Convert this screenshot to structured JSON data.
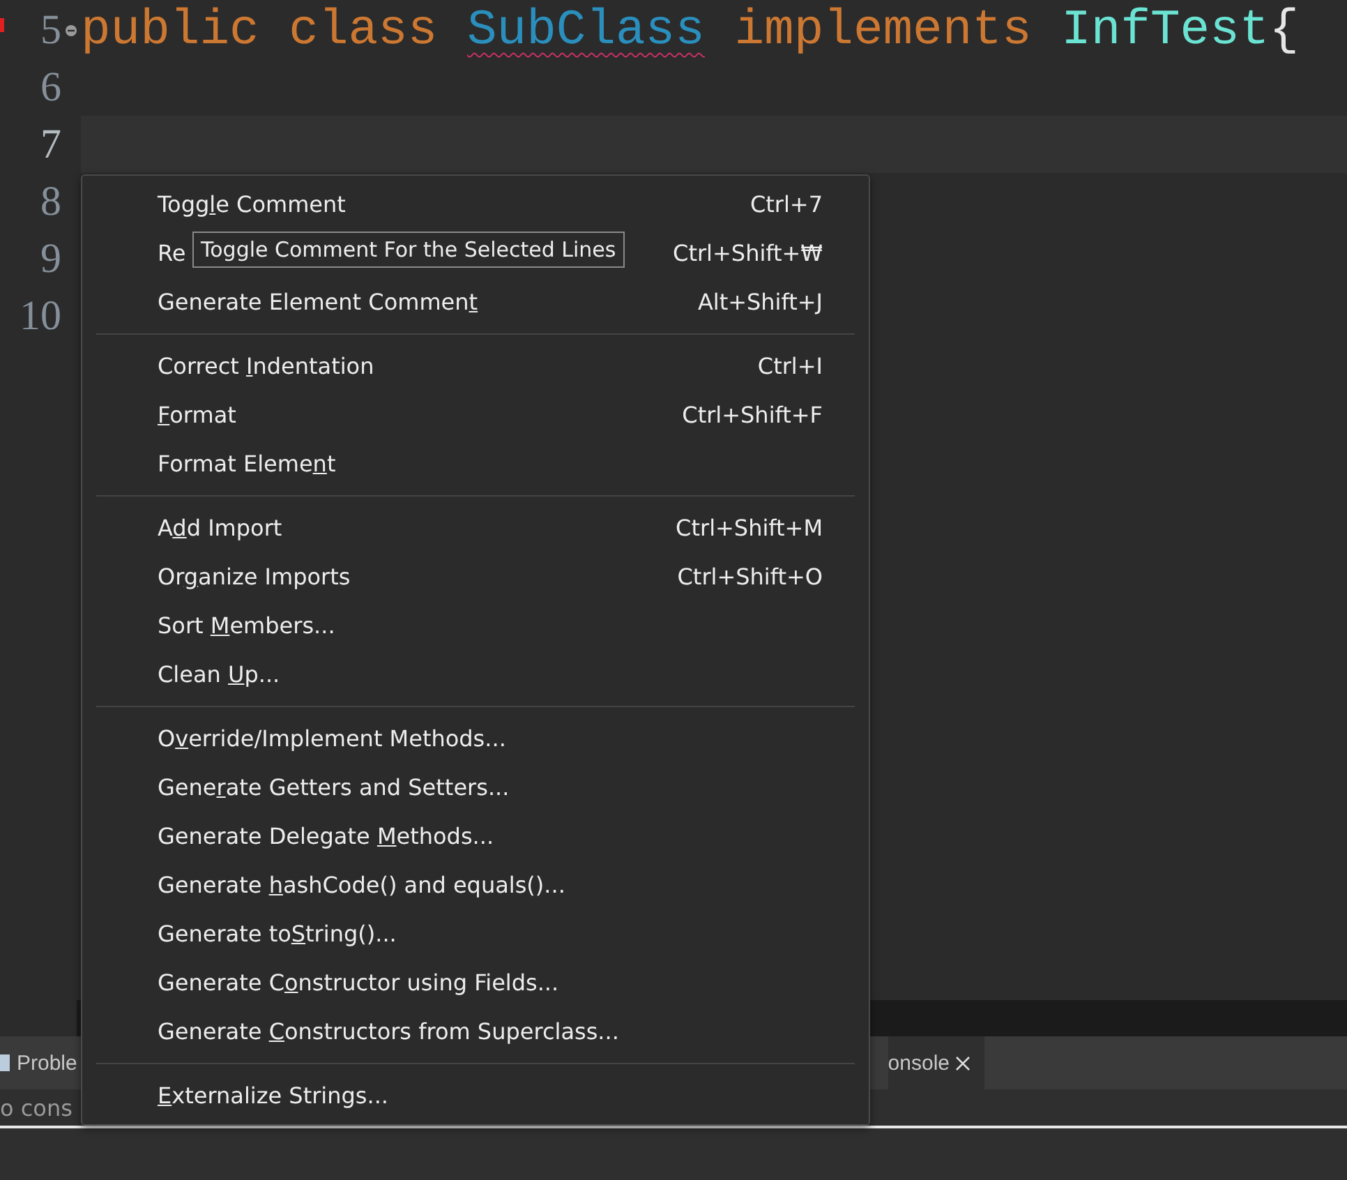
{
  "editor": {
    "lines": [
      {
        "number": "5",
        "current": false,
        "tokens": [
          {
            "kind": "keyword",
            "text": "public"
          },
          {
            "kind": "keyword",
            "text": "class"
          },
          {
            "kind": "error",
            "text": "SubClass"
          },
          {
            "kind": "keyword",
            "text": "implements"
          },
          {
            "kind": "type",
            "text": "InfTest"
          },
          {
            "kind": "plain",
            "text": "{"
          }
        ]
      },
      {
        "number": "6",
        "current": false
      },
      {
        "number": "7",
        "current": true
      },
      {
        "number": "8",
        "current": false
      },
      {
        "number": "9",
        "current": false
      },
      {
        "number": "10",
        "current": false
      }
    ]
  },
  "context_menu": {
    "groups": [
      [
        {
          "before": "Togg",
          "key": "l",
          "after": "e Comment",
          "shortcut": "Ctrl+7"
        },
        {
          "label": "Re",
          "shortcut": "Ctrl+Shift+₩"
        },
        {
          "before": "Generate Element Commen",
          "key": "t",
          "shortcut": "Alt+Shift+J"
        }
      ],
      [
        {
          "before": "Correct ",
          "key": "I",
          "after": "ndentation",
          "shortcut": "Ctrl+I"
        },
        {
          "key": "F",
          "after": "ormat",
          "shortcut": "Ctrl+Shift+F"
        },
        {
          "before": "Format Eleme",
          "key": "n",
          "after": "t"
        }
      ],
      [
        {
          "before": "A",
          "key": "d",
          "after": "d Import",
          "shortcut": "Ctrl+Shift+M"
        },
        {
          "before": "Or",
          "key": "g",
          "after": "anize Imports",
          "shortcut": "Ctrl+Shift+O"
        },
        {
          "before": "Sort ",
          "key": "M",
          "after": "embers..."
        },
        {
          "before": "Clean ",
          "key": "U",
          "after": "p..."
        }
      ],
      [
        {
          "before": "O",
          "key": "v",
          "after": "erride/Implement Methods..."
        },
        {
          "before": "Gene",
          "key": "r",
          "after": "ate Getters and Setters..."
        },
        {
          "before": "Generate Delegate ",
          "key": "M",
          "after": "ethods..."
        },
        {
          "before": "Generate ",
          "key": "h",
          "after": "ashCode() and equals()..."
        },
        {
          "before": "Generate to",
          "key": "S",
          "after": "tring()..."
        },
        {
          "before": "Generate C",
          "key": "o",
          "after": "nstructor using Fields..."
        },
        {
          "before": "Generate ",
          "key": "C",
          "after": "onstructors from Superclass..."
        }
      ],
      [
        {
          "key": "E",
          "after": "xternalize Strings..."
        }
      ]
    ]
  },
  "tooltip": "Toggle Comment For the Selected Lines",
  "bottom_panel": {
    "tabs": [
      {
        "label": "Proble",
        "selected": false
      },
      {
        "label": "onsole",
        "selected": true
      }
    ],
    "message": "o cons"
  }
}
